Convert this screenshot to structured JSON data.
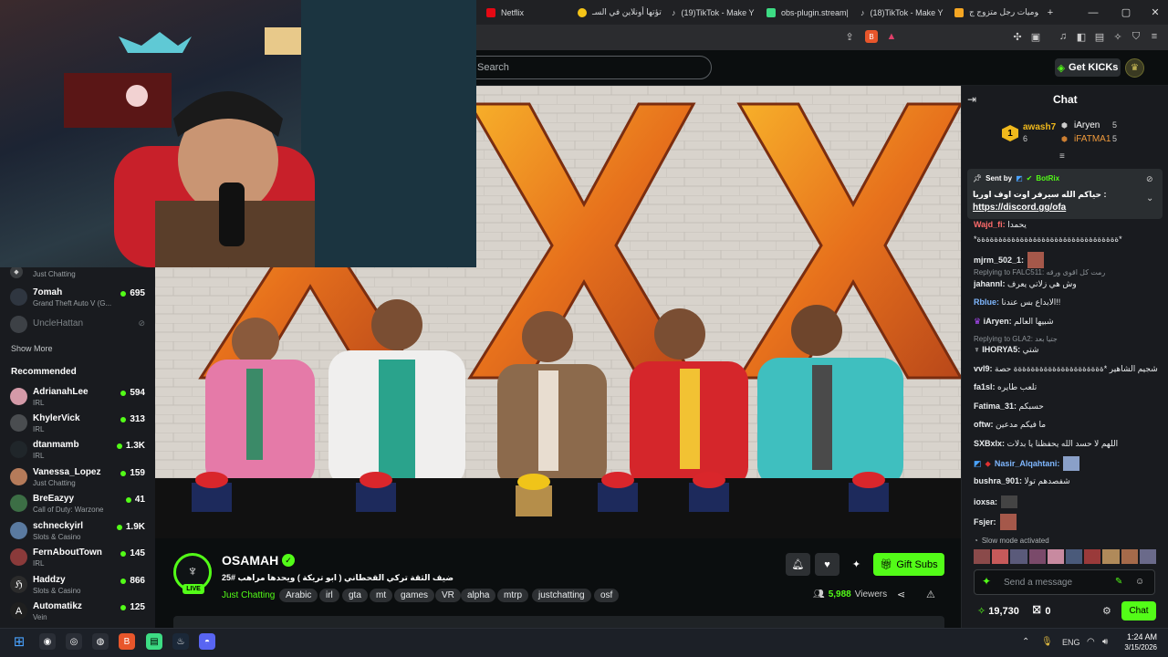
{
  "browser": {
    "tabs": [
      {
        "label": "Netflix",
        "color": "#e50914"
      },
      {
        "label": "تؤتها أونلاين في السـ",
        "color": "#f5c518"
      },
      {
        "label": "(19)TikTok - Make Y",
        "color": "#ffffff"
      },
      {
        "label": "obs-plugin.stream|",
        "color": "#3ddc84"
      },
      {
        "label": "(18)TikTok - Make Y",
        "color": "#ffffff"
      },
      {
        "label": "يوميات رجل متزوج ج",
        "color": "#f5a623"
      }
    ],
    "new_tab": "+",
    "window_buttons": [
      "—",
      "▢",
      "✕"
    ]
  },
  "kick": {
    "search_placeholder": "Search",
    "get_kicks": "Get KICKs",
    "accent": "#53fc18"
  },
  "sidebar": {
    "partial_item_category": "Just Chatting",
    "following": [
      {
        "name": "7omah",
        "category": "Grand Theft Auto V (G...",
        "viewers": "695",
        "color": "#2f3640"
      },
      {
        "name": "UncleHattan",
        "category": "",
        "viewers": "",
        "color": "#555b60",
        "offline": true
      }
    ],
    "show_more": "Show More",
    "recommended_title": "Recommended",
    "recommended": [
      {
        "name": "AdrianahLee",
        "category": "IRL",
        "viewers": "594",
        "color": "#d49aa8"
      },
      {
        "name": "KhylerVick",
        "category": "IRL",
        "viewers": "313",
        "color": "#4a4d50"
      },
      {
        "name": "dtanmamb",
        "category": "IRL",
        "viewers": "1.3K",
        "color": "#20262a"
      },
      {
        "name": "Vanessa_Lopez",
        "category": "Just Chatting",
        "viewers": "159",
        "color": "#b57b5a"
      },
      {
        "name": "BreEazyy",
        "category": "Call of Duty: Warzone",
        "viewers": "41",
        "color": "#3c6e45"
      },
      {
        "name": "schneckyirl",
        "category": "Slots & Casino",
        "viewers": "1.9K",
        "color": "#5a7aa0"
      },
      {
        "name": "FernAboutTown",
        "category": "IRL",
        "viewers": "145",
        "color": "#8a3a3a"
      },
      {
        "name": "Haddzy",
        "category": "Slots & Casino",
        "viewers": "866",
        "color": "#2b2b2b"
      },
      {
        "name": "Automatikz",
        "category": "Vein",
        "viewers": "125",
        "color": "#1f1f1f"
      }
    ]
  },
  "stream": {
    "channel": "OSAMAH",
    "live_badge": "LIVE",
    "title": "ضيف الثقة تركي القحطاني ( ابو تريكة ) ويحدها مراهب #25",
    "category": "Just Chatting",
    "tags": [
      "Arabic",
      "irl",
      "gta",
      "mt",
      "games",
      "VR",
      "alpha",
      "mtrp",
      "justchatting",
      "osf"
    ],
    "viewers": "5,988",
    "viewers_label": "Viewers",
    "gift_subs": "Gift Subs"
  },
  "chat": {
    "title": "Chat",
    "leaderboard": [
      {
        "rank": "1",
        "name": "awash7",
        "value": "6"
      },
      {
        "name": "iAryen",
        "value": "5"
      },
      {
        "name": "iFATMA1",
        "value": "5"
      }
    ],
    "pinned": {
      "sent_by_label": "Sent by",
      "sender": "BotRix",
      "text": "حياكم الله سيرفر اوت اوف اوريا :",
      "link": "https://discord.gg/ofa"
    },
    "messages": [
      {
        "user": "Wajd_fi:",
        "text": "يحمدا",
        "color": "#ff6b6b"
      },
      {
        "user": "",
        "text": "*ةةةةةةةةةةةةةةةةةةةةةةةةةةةةةةةةة*",
        "color": "#ffffff"
      },
      {
        "user": "mjrm_502_1:",
        "text": "",
        "color": "#ffffff"
      },
      {
        "user": "jahannl:",
        "text": "وش هي زلاتي يعرف",
        "color": "#ffffff",
        "reply": "Replying to FALC511: رمت كل اقوى ورقه"
      },
      {
        "user": "Rblue:",
        "text": "الابداع بس عندنا!!",
        "color": "#7fb7ff"
      },
      {
        "user": "iAryen:",
        "text": "شبيها العالم",
        "color": "#ffffff"
      },
      {
        "user": "IHORYA5:",
        "text": "شتي",
        "color": "#ffffff",
        "reply": "Replying to GLA2: جتيا بعد"
      },
      {
        "user": "vvl9:",
        "text": "شجيم الشاهير *ةةةةةةةةةةةةةةةةةةةةة حصة",
        "color": "#ffffff"
      },
      {
        "user": "fa1sl:",
        "text": "تلعب طايره",
        "color": "#ffffff"
      },
      {
        "user": "Fatima_31:",
        "text": "حسبكم",
        "color": "#ffffff"
      },
      {
        "user": "oftw:",
        "text": "ما فيكم مدعين",
        "color": "#ffffff"
      },
      {
        "user": "SXBxlx:",
        "text": "اللهم لا حسد الله يحفظنا يا بدلات",
        "color": "#ffffff"
      },
      {
        "user": "Nasir_Alqahtani:",
        "text": "",
        "color": "#7fb7ff"
      },
      {
        "user": "bushra_901:",
        "text": "شفصدهم تولا",
        "color": "#ffffff"
      },
      {
        "user": "ioxsa:",
        "text": "",
        "color": "#ffffff"
      },
      {
        "user": "Fsjer:",
        "text": "",
        "color": "#ffffff"
      }
    ],
    "slow_mode": "Slow mode activated",
    "input_placeholder": "Send a message",
    "kicks_balance": "19,730",
    "gift_count": "0",
    "send_button": "Chat"
  },
  "video_overlay": {
    "letters": [
      "X",
      "X",
      "X"
    ]
  },
  "taskbar": {
    "lang": "ENG",
    "time": "1:24 AM",
    "date": "3/15/2026"
  }
}
